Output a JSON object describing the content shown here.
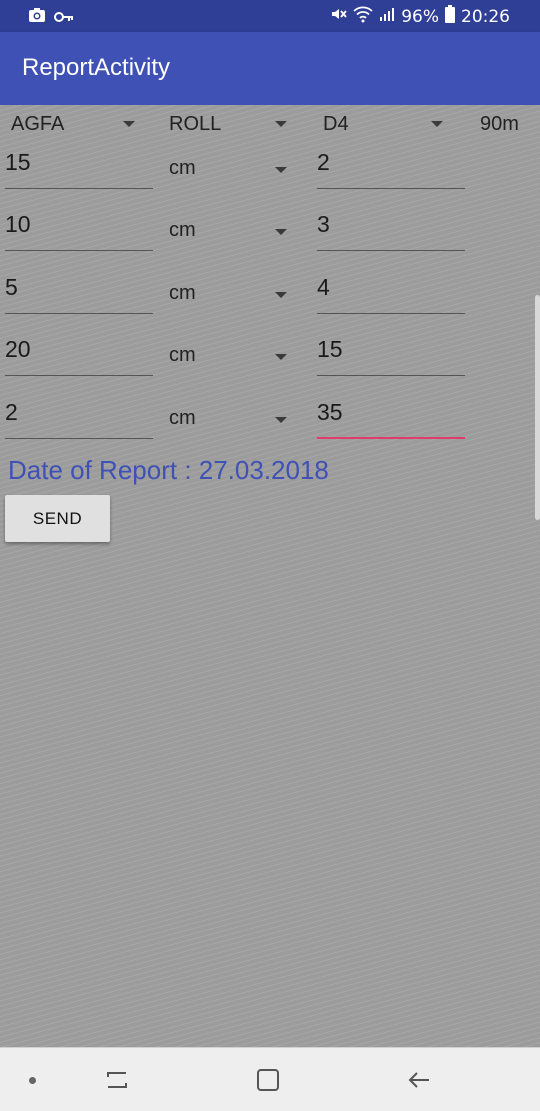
{
  "status_bar": {
    "left_icons": [
      "camera-icon",
      "key-icon"
    ],
    "right_icons": [
      "mute-icon",
      "wifi-icon",
      "signal-icon",
      "battery-icon"
    ],
    "battery_percent": "96%",
    "time": "20:26"
  },
  "app_bar": {
    "title": "ReportActivity"
  },
  "top_row": {
    "brand": "AGFA",
    "type": "ROLL",
    "model": "D4",
    "length": "90m"
  },
  "rows": [
    {
      "value": "15",
      "unit": "cm",
      "count": "2"
    },
    {
      "value": "10",
      "unit": "cm",
      "count": "3"
    },
    {
      "value": "5",
      "unit": "cm",
      "count": "4"
    },
    {
      "value": "20",
      "unit": "cm",
      "count": "15"
    },
    {
      "value": "2",
      "unit": "cm",
      "count": "35"
    }
  ],
  "date_report": "Date of Report : 27.03.2018",
  "send_label": "SEND",
  "colors": {
    "status_bar": "#2f3f96",
    "app_bar": "#3f51b5",
    "accent": "#e33a6f",
    "date_text": "#3f51b5"
  },
  "nav_bar": {
    "icons": [
      "dot-icon",
      "recent-apps-icon",
      "home-icon",
      "back-icon"
    ]
  }
}
